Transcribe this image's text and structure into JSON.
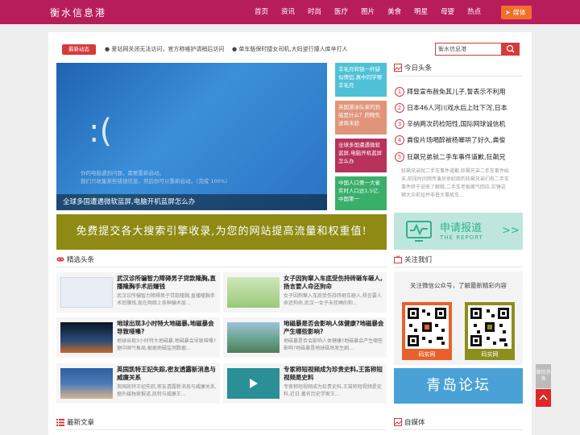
{
  "site": {
    "logo": "衡水信息港"
  },
  "nav": {
    "items": [
      "首页",
      "资讯",
      "时尚",
      "医疗",
      "图片",
      "美食",
      "明星",
      "母婴",
      "热点"
    ],
    "media_button": "媒体"
  },
  "ticker": {
    "badge": "最新动态",
    "items": [
      "爱站网关闭无法访问，官方称维护请稍后访问",
      "单车版保时捷女司机,大妈逆行撞人库辛打人"
    ]
  },
  "search": {
    "value": "衡水信息港"
  },
  "hero": {
    "caption": "全球多国遭遇微软蓝屏,电脑开机蓝屏怎么办",
    "bsod_line1": "你的电脑遇到问题，需要重新启动。",
    "bsod_line2": "我们只收集某些错误信息，然后你可以重新启动。（完成 100%）"
  },
  "side_tiles": [
    {
      "text": "羊毛月和银一杆疑似情侣,真中同学哪羊毛月",
      "color": "#4fc1d6"
    },
    {
      "text": "英国游泳队家的到底是什么？药物先进商未验",
      "color": "#e0957a"
    },
    {
      "text": "全球多国遭遇微软蓝屏,电脑开机蓝屏怎么办",
      "color": "#b8325b"
    },
    {
      "text": "中国人口第一大省实时人口达1.5亿,中国第一",
      "color": "#3aaf6a"
    }
  ],
  "banner": {
    "text": "免费提交各大搜索引擎收录,为您的网站提高流量和权重值!"
  },
  "sections": {
    "featured": "精选头条",
    "today": "今日头条",
    "follow": "关注我们",
    "latest": "最新文章",
    "media": "自媒体"
  },
  "cards": [
    {
      "title": "武汉诊所骗智力障碍男子贷款隆胸,直播隆胸手术后赚钱",
      "desc": "武汉诊所骗智力障碍男子贷款隆胸,直播隆胸手术后赚钱,现在网络上各种骗术层..."
    },
    {
      "title": "女子因狗窜入车底受伤持砖砸车砸人,扬言要人命还狗命",
      "desc": "女子因狗窜入车底受伤持砖砸车砸人,扬言要人命还狗命,武汉一女子未拴绳的狗..."
    },
    {
      "title": "地球出现3小时特大地磁暴,地磁暴会导致哑嗓?",
      "desc": "地球出现3小时特大地磁暴,地磁暴会导致哑嗓?据中国气象局,根据地磁监测数据..."
    },
    {
      "title": "地磁暴是否会影响人体健康?地磁暴会产生哪些影响?",
      "desc": "地磁暴是否会影响人体健康?地磁暴会产生哪些影响?地磁暴是地球磁场发生剧..."
    },
    {
      "title": "英国凯特王妃失踪,密友透露新消息与威廉关系",
      "desc": "英国凯特王妃失踪,密友透露新消息与威廉关系,据外媒独家报道,凯特与威廉王..."
    },
    {
      "title": "专家称短视频成为珍贵史料,王笛称短视频是史料",
      "desc": "专家称短视频成为珍贵史料,王笛称短视频是史料,近日,著名历史学家王..."
    }
  ],
  "headlines": {
    "items": [
      {
        "num": "1",
        "text": "拜登宣布赦免其儿子,誓表示不利用"
      },
      {
        "num": "2",
        "text": "日本46人河川戏水后上吐下泻,日本"
      },
      {
        "num": "3",
        "text": "辛纳两次药检阳性,国际网球诚信机"
      },
      {
        "num": "4",
        "text": "粪俊片场喝醉被杨幂哄了好久,粪俊"
      },
      {
        "num": "5",
        "text": "狂飙兄弟就二手车事件道歉,狂飙兄"
      }
    ],
    "desc": "狂飙兄弟就二手车事件道歉,狂飙兄弟二手车事件始末,前段时间网传演员徐纪周的狂飙兄弟们有二手车事件终于迎来了解释,二手车老板面气回应,实锤这辆大众前挂并非普大事故车..."
  },
  "report_ad": {
    "title": "申请报道",
    "subtitle": "THE REPORT",
    "chevron": ">>"
  },
  "wechat": {
    "title": "关注微信公众号，了解最新精彩内容",
    "qr1_label": "码实网",
    "qr2_label": "码实网"
  },
  "qingdao": {
    "text": "青岛论坛"
  },
  "float": {
    "wechat": "微信咨询"
  }
}
